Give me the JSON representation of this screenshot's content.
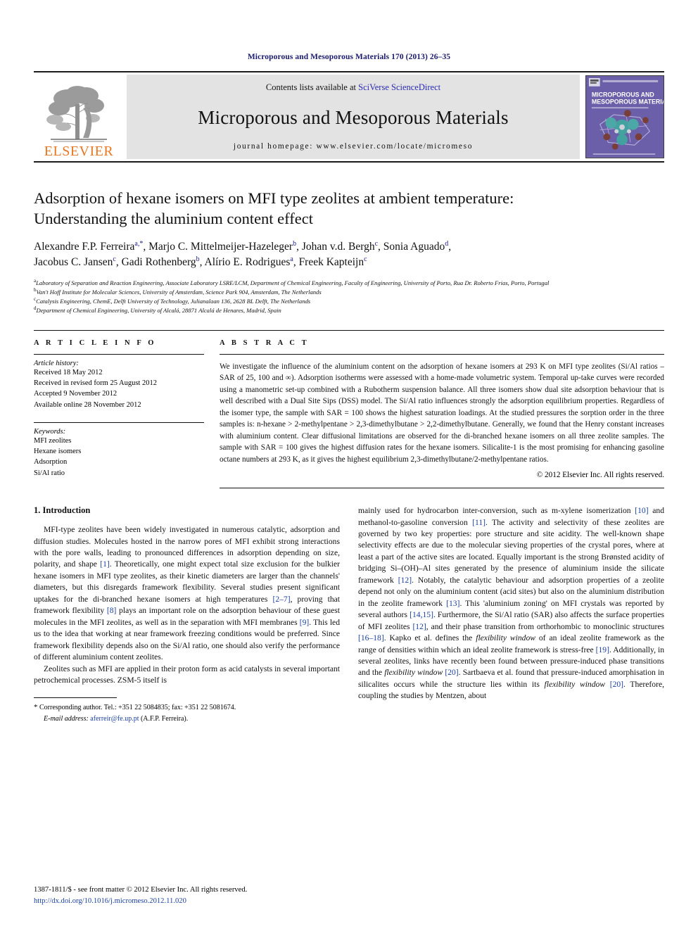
{
  "running_head": "Microporous and Mesoporous Materials 170 (2013) 26–35",
  "masthead": {
    "publisher_name": "ELSEVIER",
    "contents_prefix": "Contents lists available at ",
    "contents_link": "SciVerse ScienceDirect",
    "journal_title": "Microporous and Mesoporous Materials",
    "homepage": "journal homepage: www.elsevier.com/locate/micromeso",
    "cover_title_line1": "MICROPOROUS AND",
    "cover_title_line2": "MESOPOROUS MATERIALS"
  },
  "article": {
    "title_line1": "Adsorption of hexane isomers on MFI type zeolites at ambient temperature:",
    "title_line2": "Understanding the aluminium content effect",
    "authors_line1": "Alexandre F.P. Ferreira|a,*|, Marjo C. Mittelmeijer-Hazeleger|b|, Johan v.d. Bergh|c|, Sonia Aguado|d|,",
    "authors_line2": "Jacobus C. Jansen|c|, Gadi Rothenberg|b|, Alírio E. Rodrigues|a|, Freek Kapteijn|c|",
    "affiliations": [
      "Laboratory of Separation and Reaction Engineering, Associate Laboratory LSRE/LCM, Department of Chemical Engineering, Faculty of Engineering, University of Porto, Rua Dr. Roberto Frias, Porto, Portugal",
      "Van't Hoff Institute for Molecular Sciences, University of Amsterdam, Science Park 904, Amsterdam, The Netherlands",
      "Catalysis Engineering, ChemE, Delft University of Technology, Julianalaan 136, 2628 BL Delft, The Netherlands",
      "Department of Chemical Engineering, University of Alcalá, 28871 Alcalá de Henares, Madrid, Spain"
    ],
    "affiliation_marks": [
      "a",
      "b",
      "c",
      "d"
    ]
  },
  "article_info": {
    "heading": "A R T I C L E    I N F O",
    "history_label": "Article history:",
    "history": [
      "Received 18 May 2012",
      "Received in revised form 25 August 2012",
      "Accepted 9 November 2012",
      "Available online 28 November 2012"
    ],
    "keywords_label": "Keywords:",
    "keywords": [
      "MFI zeolites",
      "Hexane isomers",
      "Adsorption",
      "Si/Al ratio"
    ]
  },
  "abstract": {
    "heading": "A B S T R A C T",
    "text": "We investigate the influence of the aluminium content on the adsorption of hexane isomers at 293 K on MFI type zeolites (Si/Al ratios – SAR of 25, 100 and ∞). Adsorption isotherms were assessed with a home-made volumetric system. Temporal up-take curves were recorded using a manometric set-up combined with a Rubotherm suspension balance. All three isomers show dual site adsorption behaviour that is well described with a Dual Site Sips (DSS) model. The Si/Al ratio influences strongly the adsorption equilibrium properties. Regardless of the isomer type, the sample with SAR = 100 shows the highest saturation loadings. At the studied pressures the sorption order in the three samples is: n-hexane > 2-methylpentane > 2,3-dimethylbutane > 2,2-dimethylbutane. Generally, we found that the Henry constant increases with aluminium content. Clear diffusional limitations are observed for the di-branched hexane isomers on all three zeolite samples. The sample with SAR = 100 gives the highest diffusion rates for the hexane isomers. Silicalite-1 is the most promising for enhancing gasoline octane numbers at 293 K, as it gives the highest equilibrium 2,3-dimethylbutane/2-methylpentane ratios.",
    "copyright": "© 2012 Elsevier Inc. All rights reserved."
  },
  "introduction": {
    "section_number_title": "1. Introduction",
    "left_paragraph_1": "MFI-type zeolites have been widely investigated in numerous catalytic, adsorption and diffusion studies. Molecules hosted in the narrow pores of MFI exhibit strong interactions with the pore walls, leading to pronounced differences in adsorption depending on size, polarity, and shape [1]. Theoretically, one might expect total size exclusion for the bulkier hexane isomers in MFI type zeolites, as their kinetic diameters are larger than the channels' diameters, but this disregards framework flexibility. Several studies present significant uptakes for the di-branched hexane isomers at high temperatures [2–7], proving that framework flexibility [8] plays an important role on the adsorption behaviour of these guest molecules in the MFI zeolites, as well as in the separation with MFI membranes [9]. This led us to the idea that working at near framework freezing conditions would be preferred. Since framework flexibility depends also on the Si/Al ratio, one should also verify the performance of different aluminium content zeolites.",
    "left_paragraph_2": "Zeolites such as MFI are applied in their proton form as acid catalysts in several important petrochemical processes. ZSM-5 itself is",
    "right_paragraph_1": "mainly used for hydrocarbon inter-conversion, such as m-xylene isomerization [10] and methanol-to-gasoline conversion [11]. The activity and selectivity of these zeolites are governed by two key properties: pore structure and site acidity. The well-known shape selectivity effects are due to the molecular sieving properties of the crystal pores, where at least a part of the active sites are located. Equally important is the strong Brønsted acidity of bridging Si–(OH)–Al sites generated by the presence of aluminium inside the silicate framework [12]. Notably, the catalytic behaviour and adsorption properties of a zeolite depend not only on the aluminium content (acid sites) but also on the aluminium distribution in the zeolite framework [13]. This 'aluminium zoning' on MFI crystals was reported by several authors [14,15]. Furthermore, the Si/Al ratio (SAR) also affects the surface properties of MFI zeolites [12], and their phase transition from orthorhombic to monoclinic structures [16–18]. Kapko et al. defines the flexibility window of an ideal zeolite framework as the range of densities within which an ideal zeolite framework is stress-free [19]. Additionally, in several zeolites, links have recently been found between pressure-induced phase transitions and the flexibility window [20]. Sartbaeva et al. found that pressure-induced amorphisation in silicalites occurs while the structure lies within its flexibility window [20]. Therefore, coupling the studies by Mentzen, about"
  },
  "footnote": {
    "star": "*",
    "corresponding": "Corresponding author. Tel.: +351 22 5084835; fax: +351 22 5081674.",
    "email_label": "E-mail address:",
    "email": "aferreir@fe.up.pt",
    "email_suffix": "(A.F.P. Ferreira)."
  },
  "page_footer": {
    "issn_line": "1387-1811/$ - see front matter © 2012 Elsevier Inc. All rights reserved.",
    "doi": "http://dx.doi.org/10.1016/j.micromeso.2012.11.020"
  },
  "colors": {
    "link_blue": "#1a3fa0",
    "heading_navy": "#1a1a6e",
    "elsevier_orange": "#E87722",
    "cover_purple": "#6a5fa8",
    "band_grey": "#e3e3e3"
  }
}
